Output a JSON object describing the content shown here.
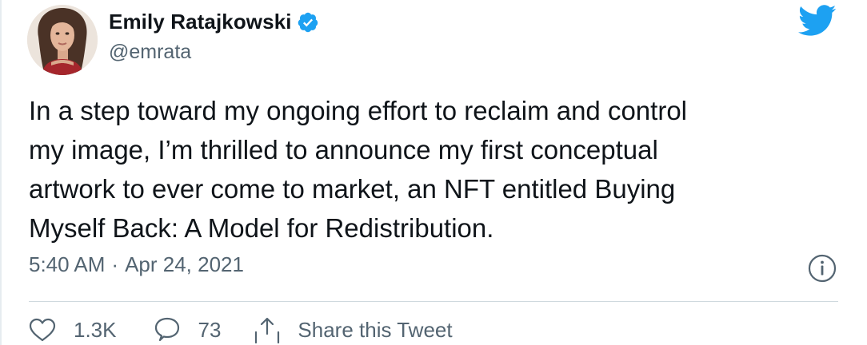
{
  "user": {
    "display_name": "Emily Ratajkowski",
    "handle": "@emrata",
    "verified": true,
    "avatar_icon": "profile-photo"
  },
  "brand": {
    "logo_icon": "twitter-bird-icon",
    "accent_color": "#1da1f2"
  },
  "tweet": {
    "lines": [
      "In a step toward my ongoing effort to reclaim and control",
      "my image, I’m thrilled to announce my first conceptual",
      "artwork to ever come to market, an NFT entitled Buying",
      "Myself Back: A Model for Redistribution."
    ]
  },
  "meta": {
    "time": "5:40 AM",
    "separator": "·",
    "date": "Apr 24, 2021",
    "info_icon": "info-icon"
  },
  "actions": {
    "like_count": "1.3K",
    "reply_count": "73",
    "share_label": "Share this Tweet"
  }
}
